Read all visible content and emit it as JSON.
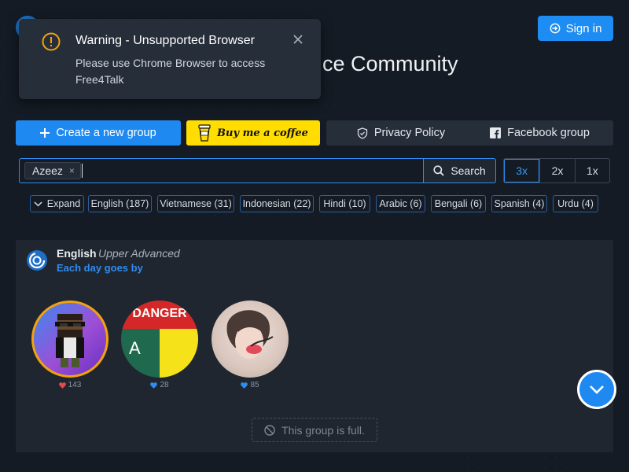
{
  "header": {
    "title_partial": "ce Community",
    "sign_in_label": "Sign in"
  },
  "toast": {
    "title": "Warning - Unsupported Browser",
    "body": "Please use Chrome Browser to access Free4Talk",
    "close": "×"
  },
  "actions": {
    "create_label": "Create a new group",
    "coffee_label": "Buy me a coffee",
    "privacy_label": "Privacy Policy",
    "facebook_label": "Facebook group"
  },
  "search": {
    "tag": "Azeez",
    "tag_remove": "×",
    "input_value": "",
    "button_label": "Search"
  },
  "zoom": {
    "options": [
      "3x",
      "2x",
      "1x"
    ],
    "selected": "3x"
  },
  "filters": {
    "expand_label": "Expand",
    "languages": [
      "English (187)",
      "Vietnamese (31)",
      "Indonesian (22)",
      "Hindi (10)",
      "Arabic (6)",
      "Bengali (6)",
      "Spanish (4)",
      "Urdu (4)"
    ]
  },
  "group": {
    "language": "English",
    "level": "Upper Advanced",
    "topic": "Each day goes by",
    "members": [
      {
        "avatar_text": "",
        "likes": "143",
        "heart_color": "#e5484d"
      },
      {
        "avatar_text": "A",
        "likes": "28",
        "heart_color": "#2f8cf0"
      },
      {
        "avatar_text": "",
        "likes": "85",
        "heart_color": "#2f8cf0"
      }
    ],
    "danger_label": "DANGER",
    "status": "This group is full."
  },
  "colors": {
    "accent": "#1e8af1",
    "coffee": "#ffdd00",
    "bg": "#141b24",
    "card": "#1f2630"
  }
}
